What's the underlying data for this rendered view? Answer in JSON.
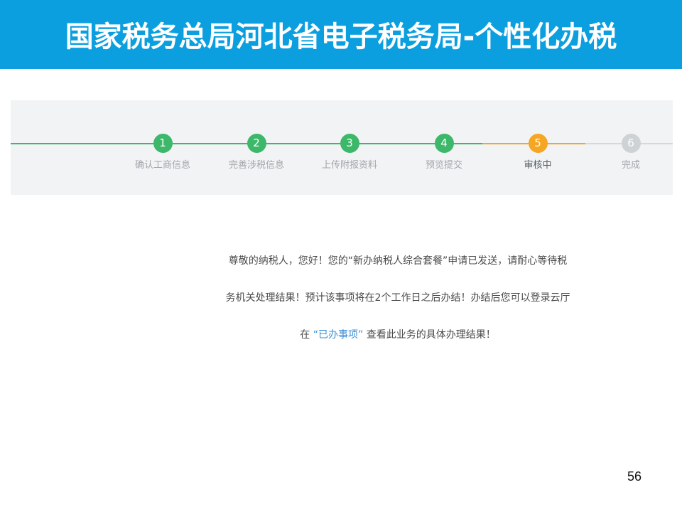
{
  "header": {
    "title": "国家税务总局河北省电子税务局-个性化办税"
  },
  "steps": [
    {
      "number": "1",
      "label": "确认工商信息",
      "state": "done"
    },
    {
      "number": "2",
      "label": "完善涉税信息",
      "state": "done"
    },
    {
      "number": "3",
      "label": "上传附报资料",
      "state": "done"
    },
    {
      "number": "4",
      "label": "预览提交",
      "state": "done"
    },
    {
      "number": "5",
      "label": "审核中",
      "state": "current"
    },
    {
      "number": "6",
      "label": "完成",
      "state": "todo"
    }
  ],
  "message": {
    "line1": "尊敬的纳税人，您好！您的“新办纳税人综合套餐”申请已发送，请耐心等待税",
    "line2": "务机关处理结果！预计该事项将在2个工作日之后办结！办结后您可以登录云厅",
    "line3_prefix": "在",
    "line3_link": "“已办事项”",
    "line3_suffix": "查看此业务的具体办理结果！"
  },
  "colors": {
    "title_bar": "#0c9fe0",
    "step_done": "#3db86a",
    "step_current": "#f5a623",
    "step_todo": "#cfd2d5",
    "link": "#3a8fd6"
  },
  "footer": {
    "page_number": "56"
  }
}
